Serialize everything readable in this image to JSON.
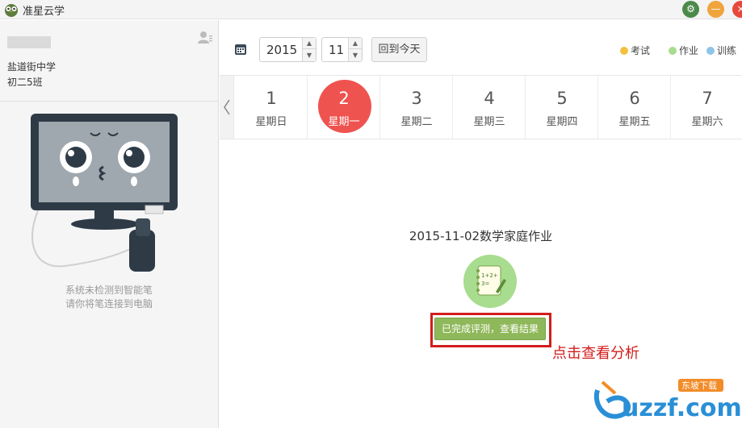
{
  "app": {
    "title": "准星云学",
    "window_controls": {
      "settings": "gear-icon",
      "minimize": "minimize-icon",
      "close": "close-icon"
    }
  },
  "sidebar": {
    "school": "盐道街中学",
    "class": "初二5班",
    "pen_message_line1": "系统未检测到智能笔",
    "pen_message_line2": "请你将笔连接到电脑"
  },
  "toolbar": {
    "year": "2015",
    "month": "11",
    "today_label": "回到今天",
    "legend": [
      {
        "label": "考试",
        "color": "#f2c13d"
      },
      {
        "label": "作业",
        "color": "#a8dc8e"
      },
      {
        "label": "训练",
        "color": "#8fc4ea"
      }
    ]
  },
  "week": {
    "days": [
      {
        "num": "1",
        "name": "星期日"
      },
      {
        "num": "2",
        "name": "星期一",
        "active": true
      },
      {
        "num": "3",
        "name": "星期二"
      },
      {
        "num": "4",
        "name": "星期三"
      },
      {
        "num": "5",
        "name": "星期四"
      },
      {
        "num": "6",
        "name": "星期五"
      },
      {
        "num": "7",
        "name": "星期六"
      }
    ]
  },
  "homework": {
    "title": "2015-11-02数学家庭作业",
    "button_label": "已完成评测，查看结果",
    "annotation": "点击查看分析",
    "icon_text": "1+2+ 3="
  },
  "watermark": {
    "text": "uzzf.com",
    "badge": "东坡下载"
  },
  "colors": {
    "active_day": "#ef5350",
    "result_button": "#8fb85a",
    "annotation": "#d21d1d"
  }
}
